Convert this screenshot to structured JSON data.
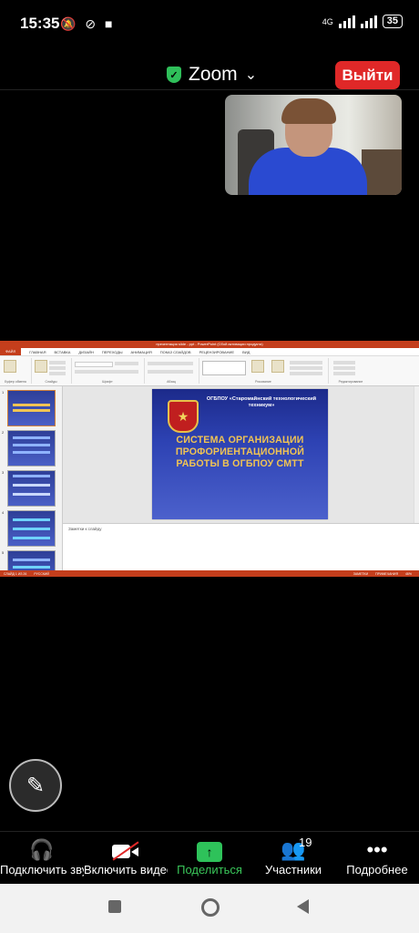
{
  "status_bar": {
    "time": "15:35",
    "network": "4G",
    "battery": "35"
  },
  "header": {
    "title": "Zoom",
    "chevron": "⌄",
    "leave_label": "Выйти"
  },
  "shared_screen": {
    "window_title": "презентация slide - ppt - PowerPoint (Сбой активации продукта)",
    "tabs": [
      "ФАЙЛ",
      "ГЛАВНАЯ",
      "ВСТАВКА",
      "ДИЗАЙН",
      "ПЕРЕХОДЫ",
      "АНИМАЦИЯ",
      "ПОКАЗ СЛАЙДОВ",
      "РЕЦЕНЗИРОВАНИЕ",
      "ВИД"
    ],
    "ribbon_groups": [
      "Буфер обмена",
      "Слайды",
      "Шрифт",
      "Абзац",
      "Рисование",
      "Редактирование"
    ],
    "slide": {
      "org_prefix": "ОГБПОУ «Старомайнский технологический техникум»",
      "heading": "СИСТЕМА ОРГАНИЗАЦИИ ПРОФОРИЕНТАЦИОННОЙ РАБОТЫ В ОГБПОУ СМТТ"
    },
    "thumb_numbers": [
      "1",
      "2",
      "3",
      "4",
      "5"
    ],
    "notes_placeholder": "Заметки к слайду",
    "status_left": "СЛАЙД 1 ИЗ 26",
    "status_lang": "РУССКИЙ",
    "status_right": [
      "ЗАМЕТКИ",
      "ПРИМЕЧАНИЯ",
      "46%"
    ]
  },
  "toolbar": {
    "items": [
      {
        "label": "Подключить звук",
        "icon": "headphones-icon"
      },
      {
        "label": "Включить видео",
        "icon": "camera-off-icon"
      },
      {
        "label": "Поделиться",
        "icon": "share-icon"
      },
      {
        "label": "Участники",
        "icon": "participants-icon",
        "badge": "19"
      },
      {
        "label": "Подробнее",
        "icon": "more-icon"
      }
    ]
  },
  "colors": {
    "leave": "#e02828",
    "share_green": "#2ec25a",
    "powerpoint": "#c43e1c"
  }
}
